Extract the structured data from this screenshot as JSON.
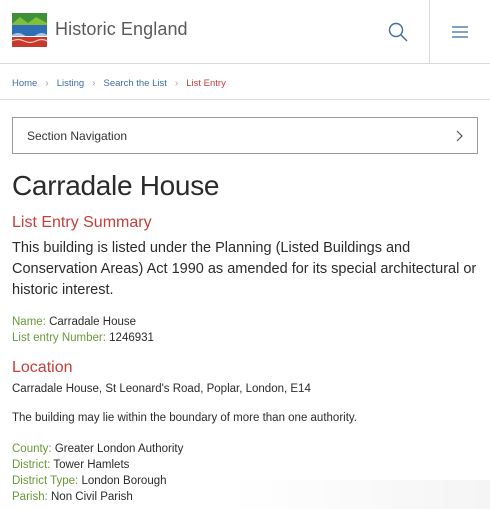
{
  "header": {
    "brand": "Historic England",
    "logo_colors": [
      "#3f8f3b",
      "#2f6eb5",
      "#c8392b"
    ]
  },
  "breadcrumb": [
    {
      "label": "Home"
    },
    {
      "label": "Listing"
    },
    {
      "label": "Search the List"
    },
    {
      "label": "List Entry"
    }
  ],
  "section_nav": {
    "label": "Section Navigation"
  },
  "title": "Carradale House",
  "summary": {
    "heading": "List Entry Summary",
    "text": "This building is listed under the Planning (Listed Buildings and Conservation Areas) Act 1990 as amended for its special architectural or historic interest.",
    "fields": [
      {
        "label": "Name:",
        "value": "Carradale House"
      },
      {
        "label": "List entry Number:",
        "value": "1246931"
      }
    ]
  },
  "location": {
    "heading": "Location",
    "address": "Carradale House, St Leonard's Road, Poplar, London, E14",
    "note": "The building may lie within the boundary of more than one authority.",
    "fields": [
      {
        "label": "County:",
        "value": "Greater London Authority"
      },
      {
        "label": "District:",
        "value": "Tower Hamlets"
      },
      {
        "label": "District Type:",
        "value": "London Borough"
      },
      {
        "label": "Parish:",
        "value": "Non Civil Parish"
      }
    ]
  },
  "colors": {
    "accent_red": "#c6403a",
    "label_green": "#6a9a3a",
    "link_blue": "#3d6fa3"
  }
}
